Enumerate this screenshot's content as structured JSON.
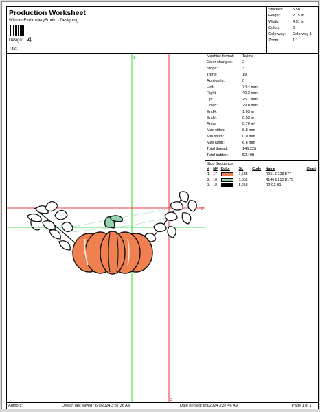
{
  "header": {
    "title": "Production Worksheet",
    "subtitle": "Wilcom EmbroideryStudio - Designing",
    "design_label": "Design:",
    "design_value": "4",
    "title_label": "Title:"
  },
  "summary": [
    {
      "label": "Stitches:",
      "value": "5,507"
    },
    {
      "label": "Height:",
      "value": "2.15 in"
    },
    {
      "label": "Width:",
      "value": "4.51 in"
    },
    {
      "label": "Colors:",
      "value": "3"
    },
    {
      "label": "Colorway:",
      "value": "Colorway 1"
    },
    {
      "label": "Zoom:",
      "value": "1:1"
    }
  ],
  "specs": [
    {
      "label": "Machine format:",
      "value": "Tajima"
    },
    {
      "label": "Color changes:",
      "value": "2"
    },
    {
      "label": "Stops:",
      "value": "3"
    },
    {
      "label": "Trims:",
      "value": "19"
    },
    {
      "label": "Appliqués:",
      "value": "0"
    },
    {
      "label": "Left:",
      "value": "74.4 mm"
    },
    {
      "label": "Right:",
      "value": "40.2 mm"
    },
    {
      "label": "Up:",
      "value": "25.7 mm"
    },
    {
      "label": "Down:",
      "value": "29.0 mm"
    },
    {
      "label": "EndX:",
      "value": "1.03 in"
    },
    {
      "label": "EndY:",
      "value": "0.53 in"
    },
    {
      "label": "Area:",
      "value": "9.70 in²"
    },
    {
      "label": "Max stitch:",
      "value": "8.8 mm"
    },
    {
      "label": "Min stitch:",
      "value": "0.0 mm"
    },
    {
      "label": "Max jump:",
      "value": "6.6 mm"
    },
    {
      "label": "Total thread:",
      "value": "145.22ft"
    },
    {
      "label": "Total bobbin:",
      "value": "52.40ft"
    }
  ],
  "stops": {
    "title": "Stop Sequence:",
    "headers": [
      "#",
      "N#",
      "Color",
      "St.",
      "Code",
      "Name",
      "Chart"
    ],
    "rows": [
      {
        "num": "1.",
        "n": "17",
        "color": "#f08050",
        "stitches": "1,685",
        "code": "",
        "name": "R251 G128 B77",
        "chart": ""
      },
      {
        "num": "2.",
        "n": "16",
        "color": "#92d2af",
        "stitches": "1,552",
        "code": "",
        "name": "R146 G210 B175",
        "chart": ""
      },
      {
        "num": "3.",
        "n": "18",
        "color": "#020201",
        "stitches": "5,258",
        "code": "",
        "name": "R2 G2 B1",
        "chart": ""
      }
    ]
  },
  "footer": {
    "authors": "Authors:",
    "saved": "Design last saved : 6/9/2024 3:37:36 AM",
    "printed": "Date printed: 6/9/2024 3:37:46 AM",
    "page": "Page 1 of 1"
  },
  "canvas": {
    "marker_1": "1",
    "marker_2": "2"
  },
  "colors": {
    "pumpkin": "#f08050",
    "leaf": "#92d2af",
    "outline": "#020201",
    "guide_green": "#00cc00",
    "guide_red": "#e00000"
  }
}
